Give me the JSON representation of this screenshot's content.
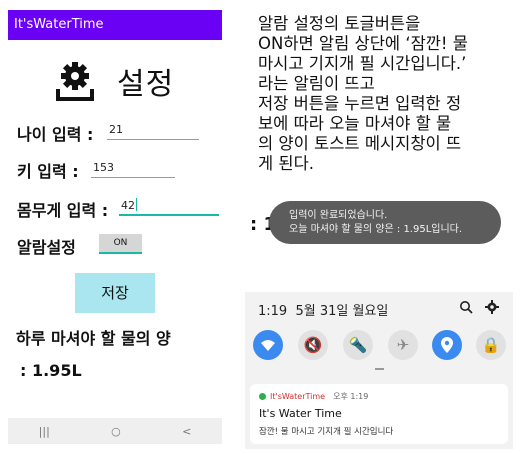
{
  "app": {
    "title": "It'sWaterTime"
  },
  "settings": {
    "title": "설정",
    "age": {
      "label": "나이 입력 :",
      "value": "21"
    },
    "height": {
      "label": "키 입력 :",
      "value": "153"
    },
    "weight": {
      "label": "몸무게 입력 :",
      "value": "42"
    },
    "alarm": {
      "label": "알람설정",
      "toggle_label": "ON"
    },
    "save_label": "저장",
    "daily_label": "하루 마셔야 할 물의 양",
    "daily_value": ": 1.95L"
  },
  "navbar": {
    "recent": "|||",
    "home": "○",
    "back": "<"
  },
  "description": {
    "lines": [
      "알람 설정의 토글버튼을",
      "ON하면 알림 상단에 ‘잠깐! 물",
      "마시고 기지개 필 시간입니다.’",
      "라는 알림이 뜨고",
      "저장 버튼을 누르면 입력한 정",
      "보에 따라 오늘 마셔야 할 물",
      "의 양이 토스트 메시지창이 뜨",
      "게 된다."
    ]
  },
  "toast": {
    "ghost_text": ": 1.",
    "line1": "입력이 완료되었습니다.",
    "line2": "오늘 마셔야 할 물의 양은 : 1.95L입니다."
  },
  "shade": {
    "time": "1:19",
    "date": "5월 31일 월요일",
    "icons": [
      "search-icon",
      "gear-icon"
    ],
    "quick_settings": [
      "wifi-icon",
      "mute-icon",
      "flashlight-icon",
      "airplane-icon",
      "location-icon",
      "rotation-lock-icon"
    ],
    "notification": {
      "app_name": "It'sWaterTime",
      "time": "오후 1:19",
      "title": "It's Water Time",
      "body": "잠깐! 물 마시고 기지개 필 시간입니다"
    }
  }
}
